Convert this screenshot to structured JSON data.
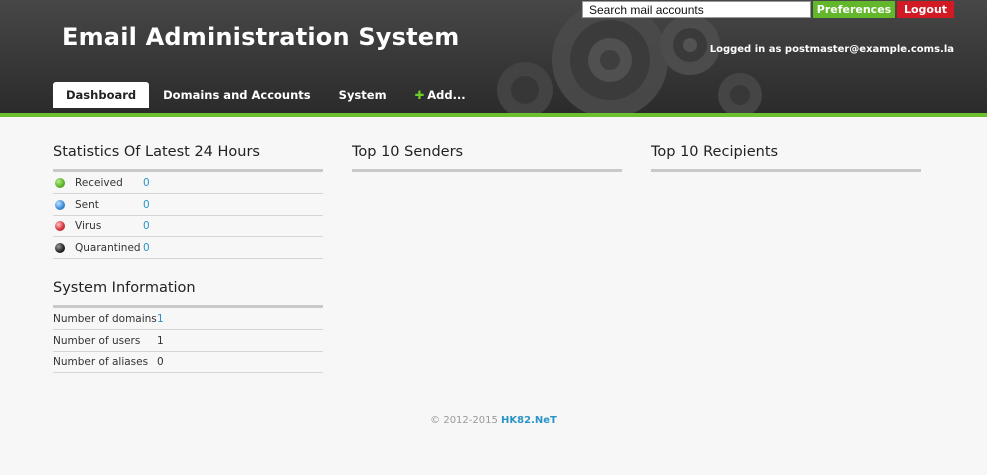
{
  "header": {
    "title": "Email Administration System",
    "search_placeholder": "Search mail accounts",
    "preferences_label": "Preferences",
    "logout_label": "Logout",
    "logged_in_text": "Logged in as postmaster@example.coms.la"
  },
  "nav": {
    "items": [
      {
        "label": "Dashboard",
        "active": true
      },
      {
        "label": "Domains and Accounts"
      },
      {
        "label": "System"
      },
      {
        "label": "Add...",
        "icon": "plus-icon"
      }
    ]
  },
  "stats": {
    "title": "Statistics Of Latest 24 Hours",
    "rows": [
      {
        "label": "Received",
        "value": "0",
        "color": "#5fb62b",
        "icon": "green-ball-icon"
      },
      {
        "label": "Sent",
        "value": "0",
        "color": "#3f8fd8",
        "icon": "blue-ball-icon"
      },
      {
        "label": "Virus",
        "value": "0",
        "color": "#d9363e",
        "icon": "red-ball-icon"
      },
      {
        "label": "Quarantined",
        "value": "0",
        "color": "#2b2b2b",
        "icon": "black-ball-icon"
      }
    ]
  },
  "system_info": {
    "title": "System Information",
    "rows": [
      {
        "label": "Number of domains",
        "value": "1"
      },
      {
        "label": "Number of users",
        "value": "1"
      },
      {
        "label": "Number of aliases",
        "value": "0"
      }
    ]
  },
  "top_senders": {
    "title": "Top 10 Senders"
  },
  "top_recipients": {
    "title": "Top 10 Recipients"
  },
  "footer": {
    "copyright": "© 2012-2015",
    "link": "HK82.NeT"
  },
  "colors": {
    "accent_green": "#6cc02e",
    "link_blue": "#2a95c8",
    "logout_red": "#d11a24"
  }
}
